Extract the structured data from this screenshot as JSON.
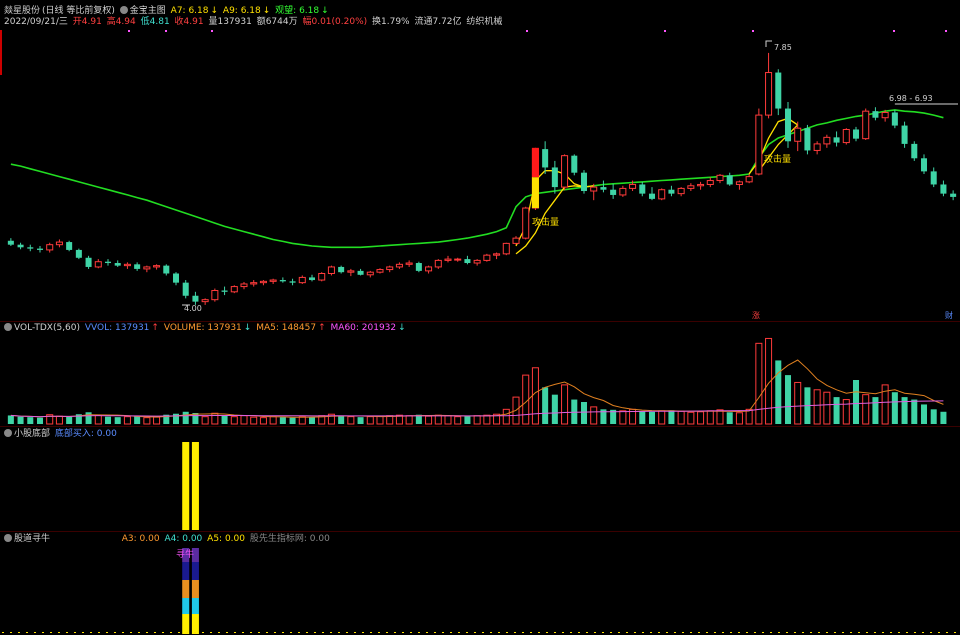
{
  "main_panel": {
    "stock_name": "燚星股份",
    "period_note": "(日线 等比前复权)",
    "indicator_name": "金宝主图",
    "a7": "A7: 6.18",
    "a9": "A9: 6.18",
    "guanwang": "观望: 6.18",
    "date": "2022/09/21/三",
    "open": "开4.91",
    "high": "高4.94",
    "low": "低4.81",
    "close": "收4.91",
    "volume": "量137931",
    "amount": "额6744万",
    "change": "幅0.01(0.20%)",
    "turnover": "换1.79%",
    "float_cap": "流通7.72亿",
    "industry": "纺织机械",
    "price_low_label": "4.00",
    "price_high_label": "7.85",
    "range_label": "6.98 - 6.93",
    "attack_label_1": "攻击量",
    "attack_label_2": "攻击量",
    "right_tag_red": "涨",
    "right_tag_blue": "财"
  },
  "vol_panel": {
    "name": "VOL-TDX(5,60)",
    "vvol": "VVOL: 137931",
    "volume": "VOLUME: 137931",
    "ma5": "MA5: 148457",
    "ma60": "MA60: 201932"
  },
  "bottom_panel": {
    "name": "小股底部",
    "value": "底部买入: 0.00"
  },
  "niu_panel": {
    "name": "股道寻牛",
    "a3": "A3: 0.00",
    "a4": "A4: 0.00",
    "a5": "A5: 0.00",
    "a6": "股先生指标网: 0.00",
    "label": "寻牛"
  },
  "colors": {
    "up": "#ff3b3b",
    "down": "#3fd4a6",
    "ma_green": "#22dd22",
    "band_yellow": "#ffe000",
    "ma5_orange": "#e08020",
    "ma60_pink": "#e060e0"
  },
  "chart_data": {
    "type": "candlestick",
    "ohlc": [
      [
        4.98,
        5.02,
        4.9,
        4.92
      ],
      [
        4.92,
        4.95,
        4.85,
        4.88
      ],
      [
        4.88,
        4.92,
        4.82,
        4.86
      ],
      [
        4.86,
        4.9,
        4.8,
        4.84
      ],
      [
        4.84,
        4.95,
        4.8,
        4.92
      ],
      [
        4.92,
        5.0,
        4.88,
        4.96
      ],
      [
        4.96,
        4.98,
        4.82,
        4.84
      ],
      [
        4.84,
        4.86,
        4.7,
        4.72
      ],
      [
        4.72,
        4.75,
        4.55,
        4.58
      ],
      [
        4.58,
        4.7,
        4.56,
        4.66
      ],
      [
        4.66,
        4.7,
        4.6,
        4.64
      ],
      [
        4.64,
        4.68,
        4.58,
        4.6
      ],
      [
        4.6,
        4.65,
        4.55,
        4.62
      ],
      [
        4.62,
        4.65,
        4.52,
        4.55
      ],
      [
        4.55,
        4.6,
        4.5,
        4.58
      ],
      [
        4.58,
        4.62,
        4.54,
        4.6
      ],
      [
        4.6,
        4.62,
        4.45,
        4.48
      ],
      [
        4.48,
        4.5,
        4.3,
        4.34
      ],
      [
        4.34,
        4.38,
        4.1,
        4.14
      ],
      [
        4.14,
        4.2,
        4.0,
        4.05
      ],
      [
        4.05,
        4.1,
        4.0,
        4.08
      ],
      [
        4.08,
        4.25,
        4.05,
        4.22
      ],
      [
        4.22,
        4.28,
        4.15,
        4.2
      ],
      [
        4.2,
        4.3,
        4.18,
        4.28
      ],
      [
        4.28,
        4.35,
        4.24,
        4.32
      ],
      [
        4.32,
        4.38,
        4.28,
        4.34
      ],
      [
        4.34,
        4.38,
        4.3,
        4.36
      ],
      [
        4.36,
        4.4,
        4.32,
        4.38
      ],
      [
        4.38,
        4.42,
        4.34,
        4.36
      ],
      [
        4.36,
        4.4,
        4.3,
        4.34
      ],
      [
        4.34,
        4.45,
        4.32,
        4.42
      ],
      [
        4.42,
        4.46,
        4.36,
        4.38
      ],
      [
        4.38,
        4.5,
        4.36,
        4.48
      ],
      [
        4.48,
        4.6,
        4.45,
        4.58
      ],
      [
        4.58,
        4.6,
        4.48,
        4.5
      ],
      [
        4.5,
        4.55,
        4.44,
        4.52
      ],
      [
        4.52,
        4.55,
        4.45,
        4.46
      ],
      [
        4.46,
        4.52,
        4.42,
        4.5
      ],
      [
        4.5,
        4.56,
        4.48,
        4.54
      ],
      [
        4.54,
        4.6,
        4.5,
        4.58
      ],
      [
        4.58,
        4.65,
        4.55,
        4.62
      ],
      [
        4.62,
        4.68,
        4.58,
        4.64
      ],
      [
        4.64,
        4.66,
        4.5,
        4.52
      ],
      [
        4.52,
        4.6,
        4.48,
        4.58
      ],
      [
        4.58,
        4.7,
        4.55,
        4.68
      ],
      [
        4.68,
        4.75,
        4.65,
        4.7
      ],
      [
        4.7,
        4.72,
        4.66,
        4.7
      ],
      [
        4.7,
        4.75,
        4.62,
        4.64
      ],
      [
        4.64,
        4.7,
        4.6,
        4.68
      ],
      [
        4.68,
        4.78,
        4.66,
        4.76
      ],
      [
        4.76,
        4.8,
        4.7,
        4.78
      ],
      [
        4.78,
        4.95,
        4.76,
        4.94
      ],
      [
        4.94,
        5.05,
        4.92,
        5.02
      ],
      [
        5.02,
        5.5,
        5.0,
        5.48
      ],
      [
        5.48,
        6.4,
        5.45,
        6.38
      ],
      [
        6.38,
        6.5,
        6.0,
        6.1
      ],
      [
        6.1,
        6.2,
        5.7,
        5.8
      ],
      [
        5.8,
        6.3,
        5.75,
        6.28
      ],
      [
        6.28,
        6.3,
        5.98,
        6.02
      ],
      [
        6.02,
        6.06,
        5.7,
        5.74
      ],
      [
        5.74,
        5.85,
        5.6,
        5.8
      ],
      [
        5.8,
        5.9,
        5.72,
        5.76
      ],
      [
        5.76,
        5.85,
        5.62,
        5.68
      ],
      [
        5.68,
        5.82,
        5.65,
        5.78
      ],
      [
        5.78,
        5.9,
        5.74,
        5.84
      ],
      [
        5.84,
        5.88,
        5.66,
        5.7
      ],
      [
        5.7,
        5.8,
        5.6,
        5.62
      ],
      [
        5.62,
        5.78,
        5.6,
        5.76
      ],
      [
        5.76,
        5.82,
        5.66,
        5.7
      ],
      [
        5.7,
        5.8,
        5.66,
        5.78
      ],
      [
        5.78,
        5.86,
        5.74,
        5.82
      ],
      [
        5.82,
        5.88,
        5.76,
        5.84
      ],
      [
        5.84,
        5.95,
        5.8,
        5.9
      ],
      [
        5.9,
        6.0,
        5.86,
        5.98
      ],
      [
        5.98,
        6.02,
        5.82,
        5.84
      ],
      [
        5.84,
        5.9,
        5.76,
        5.88
      ],
      [
        5.88,
        6.0,
        5.86,
        5.96
      ],
      [
        6.0,
        7.0,
        5.98,
        6.9
      ],
      [
        6.9,
        7.85,
        6.85,
        7.55
      ],
      [
        7.55,
        7.6,
        6.9,
        7.0
      ],
      [
        7.0,
        7.1,
        6.4,
        6.5
      ],
      [
        6.5,
        6.8,
        6.35,
        6.7
      ],
      [
        6.7,
        6.75,
        6.3,
        6.36
      ],
      [
        6.36,
        6.5,
        6.3,
        6.46
      ],
      [
        6.46,
        6.6,
        6.4,
        6.56
      ],
      [
        6.56,
        6.65,
        6.42,
        6.48
      ],
      [
        6.48,
        6.7,
        6.45,
        6.68
      ],
      [
        6.68,
        6.72,
        6.5,
        6.54
      ],
      [
        6.54,
        7.0,
        6.52,
        6.96
      ],
      [
        6.96,
        7.02,
        6.82,
        6.86
      ],
      [
        6.86,
        6.98,
        6.8,
        6.94
      ],
      [
        6.94,
        6.98,
        6.7,
        6.74
      ],
      [
        6.74,
        6.8,
        6.4,
        6.46
      ],
      [
        6.46,
        6.5,
        6.2,
        6.24
      ],
      [
        6.24,
        6.3,
        6.0,
        6.04
      ],
      [
        6.04,
        6.1,
        5.8,
        5.84
      ],
      [
        5.84,
        5.9,
        5.66,
        5.7
      ],
      [
        5.7,
        5.75,
        5.6,
        5.65
      ]
    ],
    "volume": [
      35,
      30,
      28,
      26,
      38,
      32,
      30,
      40,
      48,
      36,
      30,
      28,
      30,
      32,
      26,
      28,
      38,
      42,
      50,
      45,
      30,
      44,
      36,
      30,
      34,
      28,
      26,
      30,
      28,
      26,
      30,
      28,
      34,
      40,
      32,
      30,
      28,
      30,
      32,
      34,
      36,
      34,
      38,
      32,
      36,
      34,
      30,
      32,
      34,
      36,
      40,
      60,
      110,
      200,
      230,
      150,
      120,
      160,
      100,
      90,
      70,
      60,
      58,
      54,
      60,
      52,
      50,
      54,
      56,
      52,
      48,
      50,
      54,
      58,
      48,
      46,
      60,
      330,
      350,
      260,
      200,
      170,
      150,
      140,
      130,
      110,
      100,
      180,
      120,
      110,
      160,
      130,
      110,
      100,
      80,
      60,
      50
    ],
    "ma60_price": [
      6.15,
      6.12,
      6.08,
      6.04,
      6.0,
      5.96,
      5.92,
      5.88,
      5.84,
      5.8,
      5.76,
      5.72,
      5.68,
      5.64,
      5.6,
      5.55,
      5.5,
      5.45,
      5.4,
      5.35,
      5.3,
      5.25,
      5.2,
      5.16,
      5.12,
      5.08,
      5.04,
      5.0,
      4.97,
      4.94,
      4.92,
      4.9,
      4.89,
      4.88,
      4.88,
      4.88,
      4.88,
      4.89,
      4.9,
      4.91,
      4.92,
      4.93,
      4.94,
      4.95,
      4.96,
      4.98,
      5.0,
      5.02,
      5.05,
      5.08,
      5.12,
      5.18,
      5.5,
      5.65,
      5.7,
      5.72,
      5.74,
      5.76,
      5.78,
      5.8,
      5.82,
      5.84,
      5.85,
      5.86,
      5.87,
      5.88,
      5.89,
      5.9,
      5.91,
      5.92,
      5.93,
      5.94,
      5.95,
      5.96,
      5.97,
      5.98,
      6.0,
      6.25,
      6.45,
      6.55,
      6.6,
      6.65,
      6.7,
      6.75,
      6.78,
      6.82,
      6.85,
      6.88,
      6.9,
      6.93,
      6.96,
      6.98,
      6.96,
      6.95,
      6.93,
      6.9,
      6.86
    ],
    "ylim": [
      3.8,
      8.2
    ]
  }
}
